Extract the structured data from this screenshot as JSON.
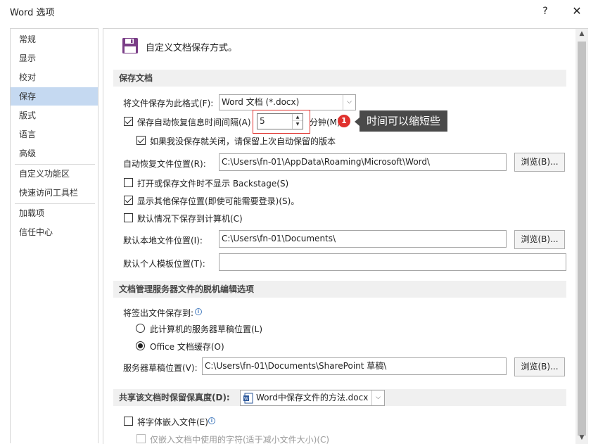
{
  "window": {
    "title": "Word 选项",
    "help": "?",
    "close": "✕"
  },
  "nav": {
    "items": [
      {
        "label": "常规"
      },
      {
        "label": "显示"
      },
      {
        "label": "校对"
      },
      {
        "label": "保存",
        "selected": true
      },
      {
        "label": "版式"
      },
      {
        "label": "语言"
      },
      {
        "label": "高级"
      },
      {
        "label": "自定义功能区"
      },
      {
        "label": "快速访问工具栏"
      },
      {
        "label": "加载项"
      },
      {
        "label": "信任中心"
      }
    ]
  },
  "header": {
    "icon": "save-floppy-icon",
    "text": "自定义文档保存方式。"
  },
  "sections": {
    "save_docs": "保存文档",
    "offline": "文档管理服务器文件的脱机编辑选项",
    "fidelity": "共享该文档时保留保真度(D):"
  },
  "save": {
    "format_label": "将文件保存为此格式(F):",
    "format_value": "Word 文档 (*.docx)",
    "autorecover_label": "保存自动恢复信息时间间隔(A)",
    "autorecover_checked": true,
    "autorecover_minutes": "5",
    "minutes_label": "分钟(M)",
    "keep_last_label": "如果我没保存就关闭，请保留上次自动保留的版本",
    "keep_last_checked": true,
    "autorecover_path_label": "自动恢复文件位置(R):",
    "autorecover_path": "C:\\Users\\fn-01\\AppData\\Roaming\\Microsoft\\Word\\",
    "browse1": "浏览(B)...",
    "no_backstage_label": "打开或保存文件时不显示 Backstage(S)",
    "no_backstage_checked": false,
    "show_other_label": "显示其他保存位置(即使可能需要登录)(S)。",
    "show_other_checked": true,
    "default_computer_label": "默认情况下保存到计算机(C)",
    "default_computer_checked": false,
    "local_path_label": "默认本地文件位置(I):",
    "local_path": "C:\\Users\\fn-01\\Documents\\",
    "browse2": "浏览(B)...",
    "template_label": "默认个人模板位置(T):",
    "template_path": ""
  },
  "offline": {
    "checkout_label": "将签出文件保存到:",
    "option_server": "此计算机的服务器草稿位置(L)",
    "option_cache": "Office 文档缓存(O)",
    "selected": "cache",
    "drafts_label": "服务器草稿位置(V):",
    "drafts_path": "C:\\Users\\fn-01\\Documents\\SharePoint 草稿\\",
    "browse3": "浏览(B)..."
  },
  "fidelity": {
    "doc_value": "Word中保存文件的方法.docx",
    "embed_fonts_label": "将字体嵌入文件(E)",
    "embed_fonts_checked": false,
    "embed_used_label": "仅嵌入文档中使用的字符(适于减小文件大小)(C)"
  },
  "annotation": {
    "badge": "1",
    "callout": "时间可以缩短些",
    "color": "#e0312d"
  }
}
